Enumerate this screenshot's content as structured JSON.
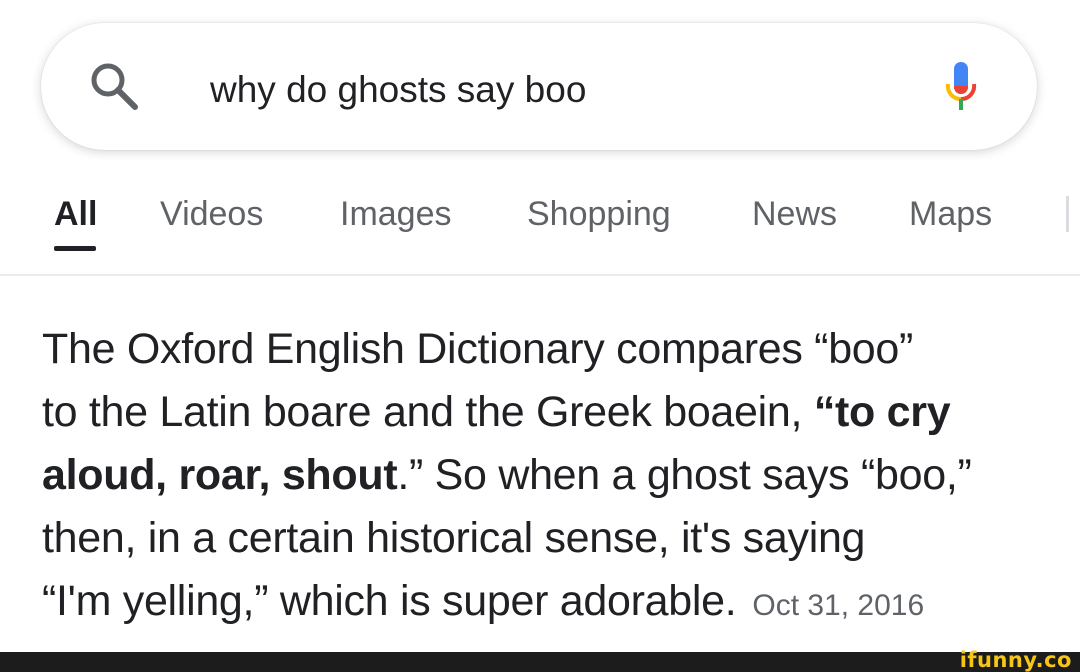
{
  "search": {
    "query": "why do ghosts say boo",
    "icons": {
      "search": "search-icon",
      "mic": "microphone-icon"
    }
  },
  "tabs": [
    {
      "label": "All",
      "active": true
    },
    {
      "label": "Videos",
      "active": false
    },
    {
      "label": "Images",
      "active": false
    },
    {
      "label": "Shopping",
      "active": false
    },
    {
      "label": "News",
      "active": false
    },
    {
      "label": "Maps",
      "active": false
    }
  ],
  "answer": {
    "line1": "The Oxford English Dictionary compares “boo”",
    "line2_plain": "to the Latin boare and the Greek boaein, ",
    "line2_bold": "“to cry",
    "line3_bold": "aloud, roar, shout",
    "line3_plain": ".” So when a ghost says “boo,”",
    "line4": "then, in a certain historical sense, it's saying",
    "line5": "“I'm yelling,” which is super adorable.",
    "date": "Oct 31, 2016"
  },
  "watermark": "ifunny.co",
  "colors": {
    "text": "#202124",
    "muted": "#5f6368",
    "mic_blue": "#4285f4",
    "mic_red": "#ea4335",
    "mic_yellow": "#fbbc05",
    "mic_green": "#34a853",
    "watermark": "#f5c518"
  }
}
